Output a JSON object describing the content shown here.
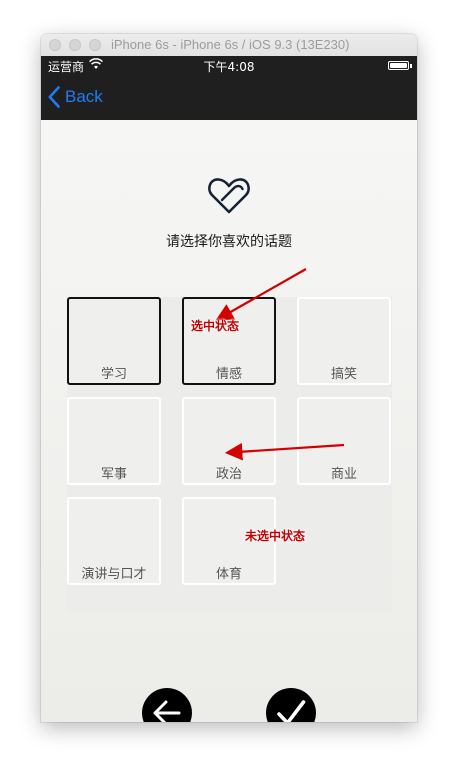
{
  "window": {
    "title": "iPhone 6s - iPhone 6s / iOS 9.3 (13E230)"
  },
  "status_bar": {
    "carrier": "运营商",
    "time": "下午4:08"
  },
  "nav": {
    "back_label": "Back"
  },
  "main": {
    "prompt": "请选择你喜欢的话题",
    "topics": [
      {
        "label": "学习",
        "selected": true
      },
      {
        "label": "情感",
        "selected": true
      },
      {
        "label": "搞笑",
        "selected": false
      },
      {
        "label": "军事",
        "selected": false
      },
      {
        "label": "政治",
        "selected": false
      },
      {
        "label": "商业",
        "selected": false
      },
      {
        "label": "演讲与口才",
        "selected": false
      },
      {
        "label": "体育",
        "selected": false
      }
    ]
  },
  "annotations": {
    "selected_state": "选中状态",
    "unselected_state": "未选中状态"
  },
  "footer": {
    "back_icon": "arrow-left-icon",
    "confirm_icon": "checkmark-icon"
  },
  "colors": {
    "accent": "#1f7cf7",
    "bar_bg": "#1f1f1f",
    "annotation": "#d40000"
  }
}
